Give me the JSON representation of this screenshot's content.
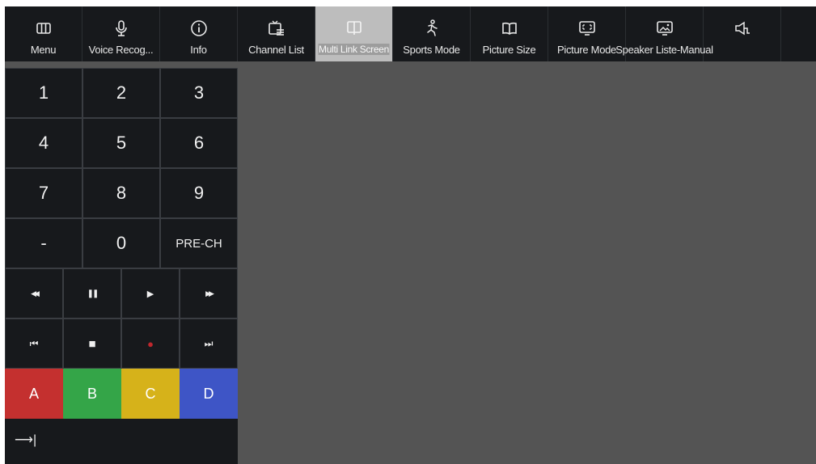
{
  "toolbar": {
    "items": [
      {
        "label": "Menu",
        "icon": "columns-icon"
      },
      {
        "label": "Voice Recog...",
        "icon": "microphone-icon"
      },
      {
        "label": "Info",
        "icon": "info-icon"
      },
      {
        "label": "Channel List",
        "icon": "tv-list-icon"
      },
      {
        "label": "Multi Link Screen",
        "icon": "split-screen-icon"
      },
      {
        "label": "Sports Mode",
        "icon": "running-person-icon"
      },
      {
        "label": "Picture Size",
        "icon": "book-open-icon"
      },
      {
        "label": "Picture Mode",
        "icon": "monitor-focus-icon"
      },
      {
        "label": "Speaker Liste-Manual",
        "icon": "picture-icon"
      },
      {
        "label": "",
        "icon": "speaker-icon"
      }
    ]
  },
  "keypad": {
    "keys": [
      "1",
      "2",
      "3",
      "4",
      "5",
      "6",
      "7",
      "8",
      "9",
      "-",
      "0",
      "PRE-CH"
    ]
  },
  "media": {
    "rewind": "◀◀",
    "pause": "❚❚",
    "play": "▶",
    "fast_forward": "▶▶",
    "prev": "⏮",
    "stop": "■",
    "record": "●",
    "next": "⏭"
  },
  "color_keys": [
    {
      "label": "A",
      "color": "#c4302f"
    },
    {
      "label": "B",
      "color": "#34a548"
    },
    {
      "label": "C",
      "color": "#d6b21a"
    },
    {
      "label": "D",
      "color": "#3e55c6"
    }
  ],
  "tab_key": {
    "label": "⟶|"
  },
  "colors": {
    "background": "#545454",
    "bar": "#17191c",
    "record": "#c0272d"
  }
}
